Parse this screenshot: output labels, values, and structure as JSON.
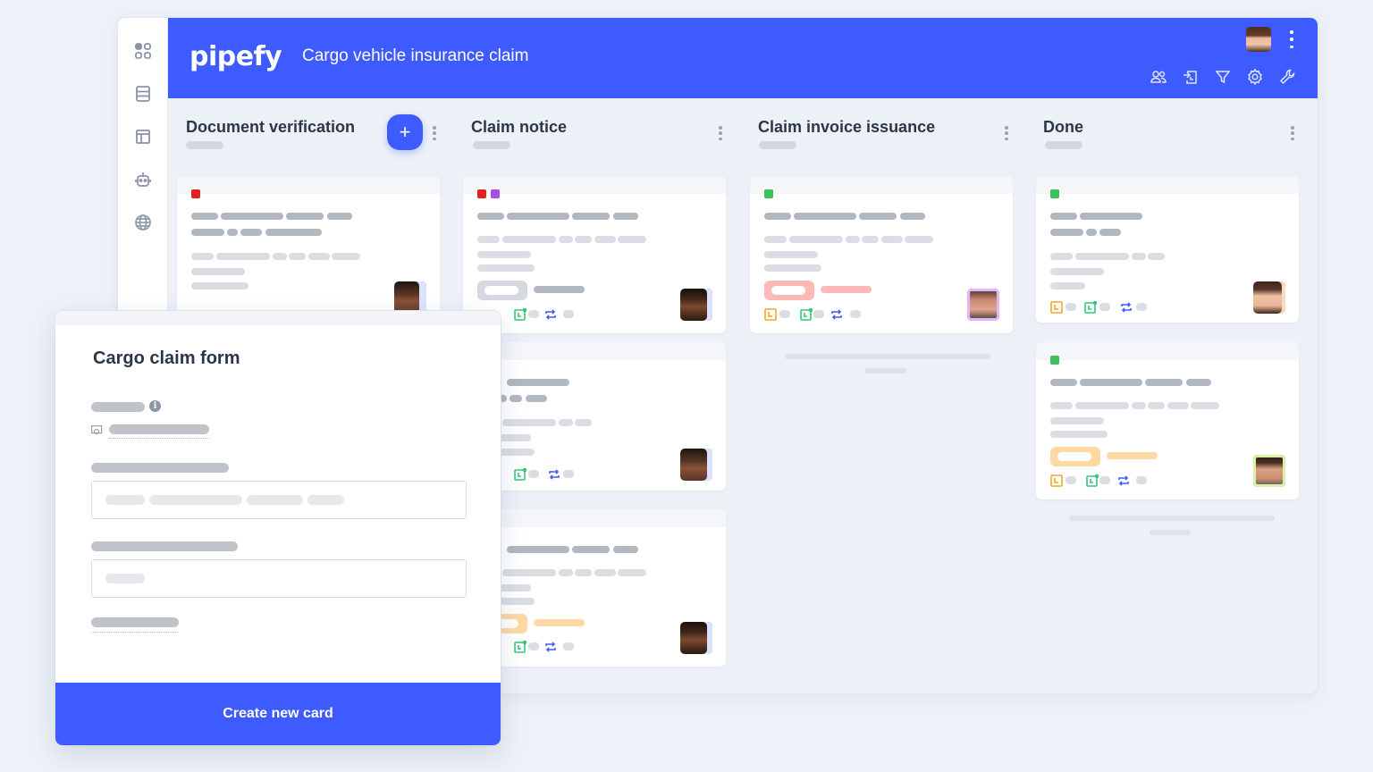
{
  "app": {
    "logo": "pipefy",
    "pipe_title": "Cargo vehicle insurance claim",
    "brand_color": "#3e5bff"
  },
  "sidebar": {
    "items": [
      {
        "icon": "apps-grid-icon"
      },
      {
        "icon": "database-icon"
      },
      {
        "icon": "layout-panel-icon"
      },
      {
        "icon": "robot-icon"
      },
      {
        "icon": "globe-icon"
      }
    ]
  },
  "header": {
    "tools": [
      {
        "icon": "members-icon"
      },
      {
        "icon": "import-icon"
      },
      {
        "icon": "filter-icon"
      },
      {
        "icon": "settings-gear-icon"
      },
      {
        "icon": "wrench-icon"
      }
    ]
  },
  "columns": [
    {
      "title": "Document verification",
      "has_add_button": true,
      "add_label": "+"
    },
    {
      "title": "Claim notice"
    },
    {
      "title": "Claim invoice issuance"
    },
    {
      "title": "Done"
    }
  ],
  "tag_colors": {
    "red": "#e02424",
    "purple": "#a64fe0",
    "green": "#3fbf5a"
  },
  "pill_colors": {
    "gray": "#d6dae0",
    "pink": "#ffb8b8",
    "orange": "#ffd9a3"
  },
  "form": {
    "title": "Cargo claim form",
    "submit_label": "Create new card"
  }
}
